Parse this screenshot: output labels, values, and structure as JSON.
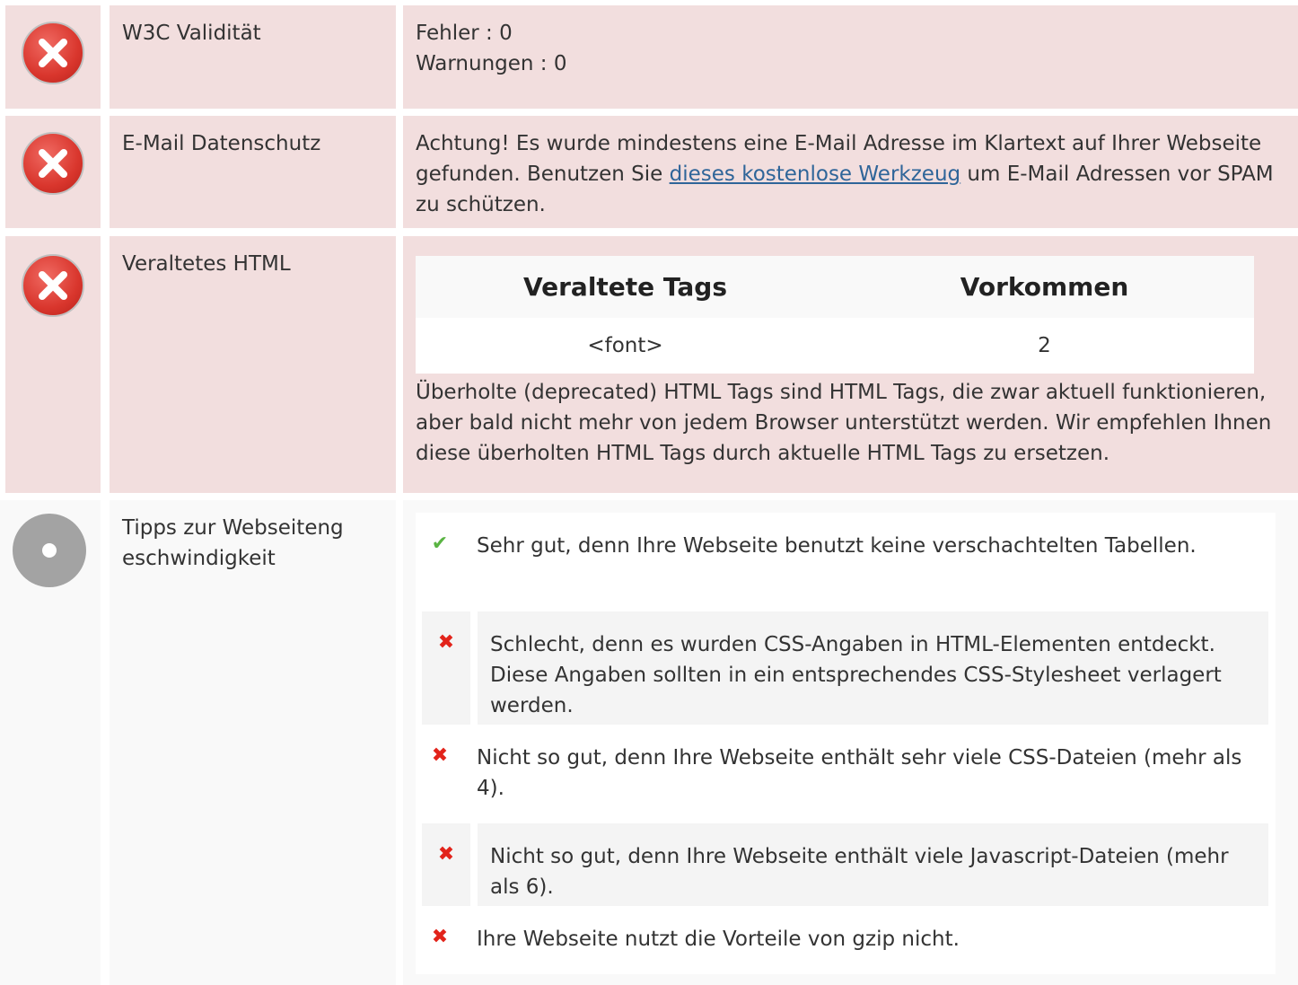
{
  "rows": [
    {
      "label": "W3C Validität",
      "status": "error",
      "lines": [
        "Fehler : 0",
        "Warnungen : 0"
      ]
    },
    {
      "label": "E-Mail Datenschutz",
      "status": "error",
      "text_before": "Achtung! Es wurde mindestens eine E-Mail Adresse im Klartext auf Ihrer Webseite gefunden. Benutzen Sie ",
      "link_text": "dieses kostenlose Werkzeug",
      "text_after": " um E-Mail Adressen vor SPAM zu schützen."
    },
    {
      "label": "Veraltetes HTML",
      "status": "error",
      "table_headers": [
        "Veraltete Tags",
        "Vorkommen"
      ],
      "table_rows": [
        [
          "<font>",
          "2"
        ]
      ],
      "description": "Überholte (deprecated) HTML Tags sind HTML Tags, die zwar aktuell funktionieren, aber bald nicht mehr von jedem Browser unterstützt werden. Wir empfehlen Ihnen diese überholten HTML Tags durch aktuelle HTML Tags zu ersetzen."
    },
    {
      "label": "Tipps zur Webseiteng eschwindigkeit",
      "status": "neutral",
      "tips": [
        {
          "icon": "check-icon",
          "text": "Sehr gut, denn Ihre Webseite benutzt keine verschachtelten Tabellen."
        },
        {
          "icon": "cross-icon",
          "text": "Schlecht, denn es wurden CSS-Angaben in HTML-Elementen entdeckt. Diese Angaben sollten in ein entsprechendes CSS-Stylesheet verlagert werden."
        },
        {
          "icon": "cross-icon",
          "text": "Nicht so gut, denn Ihre Webseite enthält sehr viele CSS-Dateien (mehr als 4)."
        },
        {
          "icon": "cross-icon",
          "text": "Nicht so gut, denn Ihre Webseite enthält viele Javascript-Dateien (mehr als 6)."
        },
        {
          "icon": "cross-icon",
          "text": "Ihre Webseite nutzt die Vorteile von gzip nicht."
        }
      ]
    }
  ],
  "colors": {
    "error_bg": "#f2dede",
    "neutral_bg": "#f9f9f9",
    "check": "#5ab443",
    "cross": "#e2231a",
    "link": "#2f6599"
  }
}
